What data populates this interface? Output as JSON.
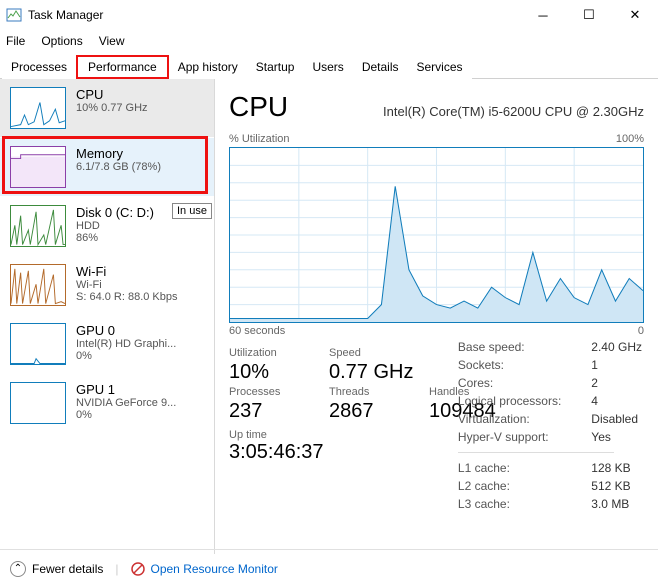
{
  "window": {
    "title": "Task Manager"
  },
  "menu": {
    "file": "File",
    "options": "Options",
    "view": "View"
  },
  "tabs": {
    "processes": "Processes",
    "performance": "Performance",
    "app_history": "App history",
    "startup": "Startup",
    "users": "Users",
    "details": "Details",
    "services": "Services"
  },
  "sidebar": {
    "cpu": {
      "title": "CPU",
      "sub": "10% 0.77 GHz"
    },
    "mem": {
      "title": "Memory",
      "sub": "6.1/7.8 GB (78%)"
    },
    "disk": {
      "title": "Disk 0 (C: D:)",
      "sub1": "HDD",
      "sub2": "86%",
      "tooltip": "In use"
    },
    "wifi": {
      "title": "Wi-Fi",
      "sub1": "Wi-Fi",
      "sub2": "S: 64.0  R: 88.0 Kbps"
    },
    "gpu0": {
      "title": "GPU 0",
      "sub1": "Intel(R) HD Graphi...",
      "sub2": "0%"
    },
    "gpu1": {
      "title": "GPU 1",
      "sub1": "NVIDIA GeForce 9...",
      "sub2": "0%"
    }
  },
  "detail": {
    "title": "CPU",
    "model": "Intel(R) Core(TM) i5-6200U CPU @ 2.30GHz",
    "chart_top_left": "% Utilization",
    "chart_top_right": "100%",
    "chart_bottom_left": "60 seconds",
    "chart_bottom_right": "0",
    "stats": {
      "utilization_l": "Utilization",
      "utilization_v": "10%",
      "speed_l": "Speed",
      "speed_v": "0.77 GHz",
      "processes_l": "Processes",
      "processes_v": "237",
      "threads_l": "Threads",
      "threads_v": "2867",
      "handles_l": "Handles",
      "handles_v": "109484",
      "uptime_l": "Up time",
      "uptime_v": "3:05:46:37"
    },
    "right": {
      "base_speed_l": "Base speed:",
      "base_speed_v": "2.40 GHz",
      "sockets_l": "Sockets:",
      "sockets_v": "1",
      "cores_l": "Cores:",
      "cores_v": "2",
      "logical_l": "Logical processors:",
      "logical_v": "4",
      "virt_l": "Virtualization:",
      "virt_v": "Disabled",
      "hyperv_l": "Hyper-V support:",
      "hyperv_v": "Yes",
      "l1_l": "L1 cache:",
      "l1_v": "128 KB",
      "l2_l": "L2 cache:",
      "l2_v": "512 KB",
      "l3_l": "L3 cache:",
      "l3_v": "3.0 MB"
    }
  },
  "footer": {
    "fewer": "Fewer details",
    "resmon": "Open Resource Monitor"
  },
  "chart_data": {
    "type": "line",
    "title": "CPU % Utilization",
    "xlabel": "seconds ago",
    "ylabel": "% Utilization",
    "xlim": [
      60,
      0
    ],
    "ylim": [
      0,
      100
    ],
    "x": [
      60,
      58,
      56,
      54,
      52,
      50,
      48,
      46,
      44,
      42,
      40,
      38,
      36,
      34,
      32,
      30,
      28,
      26,
      24,
      22,
      20,
      18,
      16,
      14,
      12,
      10,
      8,
      6,
      4,
      2,
      0
    ],
    "values": [
      2,
      2,
      2,
      2,
      2,
      2,
      2,
      2,
      2,
      2,
      2,
      10,
      78,
      30,
      15,
      10,
      8,
      12,
      8,
      20,
      14,
      10,
      40,
      12,
      25,
      14,
      10,
      30,
      12,
      25,
      18
    ]
  }
}
